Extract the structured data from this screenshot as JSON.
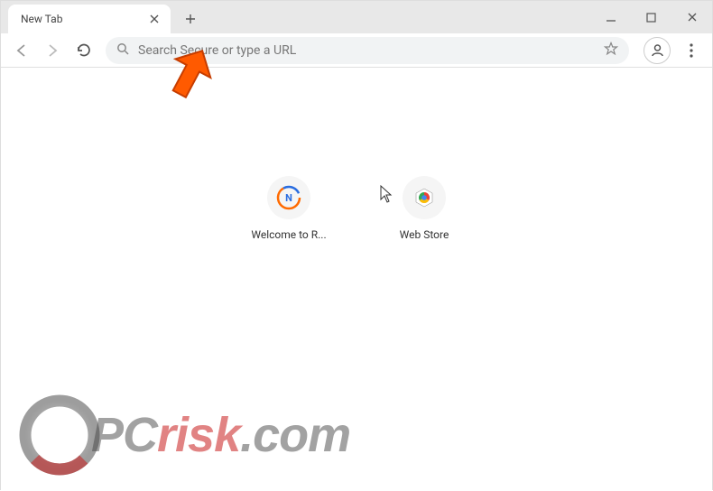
{
  "window": {
    "tab_title": "New Tab"
  },
  "toolbar": {
    "omnibox_placeholder": "Search Secure or type a URL"
  },
  "shortcuts": [
    {
      "label": "Welcome to R...",
      "icon": "n-logo"
    },
    {
      "label": "Web Store",
      "icon": "webstore"
    }
  ],
  "watermark": {
    "text_prefix": "PC",
    "text_mid": "risk",
    "text_suffix": ".com"
  }
}
